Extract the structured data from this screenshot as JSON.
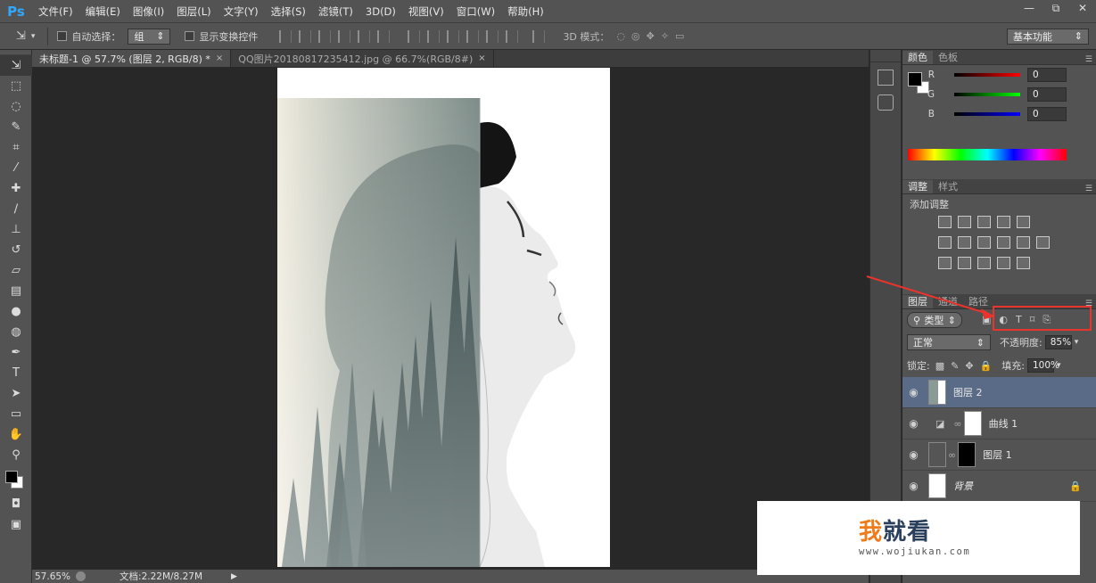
{
  "app": {
    "logo": "Ps"
  },
  "menu": [
    "文件(F)",
    "编辑(E)",
    "图像(I)",
    "图层(L)",
    "文字(Y)",
    "选择(S)",
    "滤镜(T)",
    "3D(D)",
    "视图(V)",
    "窗口(W)",
    "帮助(H)"
  ],
  "window_controls": {
    "minimize": "—",
    "restore": "⧉",
    "close": "✕"
  },
  "options": {
    "auto_select_label": "自动选择：",
    "auto_select_value": "组",
    "show_transform_label": "显示变换控件",
    "mode_3d_label": "3D 模式：",
    "workspace": "基本功能"
  },
  "tabs": [
    {
      "label": "未标题-1 @ 57.7% (图层 2, RGB/8) *",
      "close": "×"
    },
    {
      "label": "QQ图片20180817235412.jpg @ 66.7%(RGB/8#)",
      "close": "×"
    }
  ],
  "status": {
    "zoom": "57.65%",
    "doc": "文档:2.22M/8.27M",
    "arrow": "▶"
  },
  "color_panel": {
    "tabs": [
      "颜色",
      "色板"
    ],
    "channels": [
      {
        "label": "R",
        "value": "0"
      },
      {
        "label": "G",
        "value": "0"
      },
      {
        "label": "B",
        "value": "0"
      }
    ]
  },
  "adjust_panel": {
    "tabs": [
      "调整",
      "样式"
    ],
    "title": "添加调整"
  },
  "layers_panel": {
    "tabs": [
      "图层",
      "通道",
      "路径"
    ],
    "filter": "类型",
    "blend_mode": "正常",
    "opacity_label": "不透明度:",
    "opacity_value": "85%",
    "lock_label": "锁定:",
    "fill_label": "填充:",
    "fill_value": "100%",
    "layers": [
      {
        "name": "图层 2",
        "selected": true
      },
      {
        "name": "曲线 1",
        "selected": false
      },
      {
        "name": "图层 1",
        "selected": false
      },
      {
        "name": "背景",
        "selected": false,
        "locked": true
      }
    ]
  },
  "watermark": {
    "title_1": "我",
    "title_2": "就看",
    "url": "www.wojiukan.com"
  },
  "colors": {
    "annotation_red": "#e8342c",
    "selection": "#5a6b88",
    "ps_blue": "#31a8ff"
  }
}
